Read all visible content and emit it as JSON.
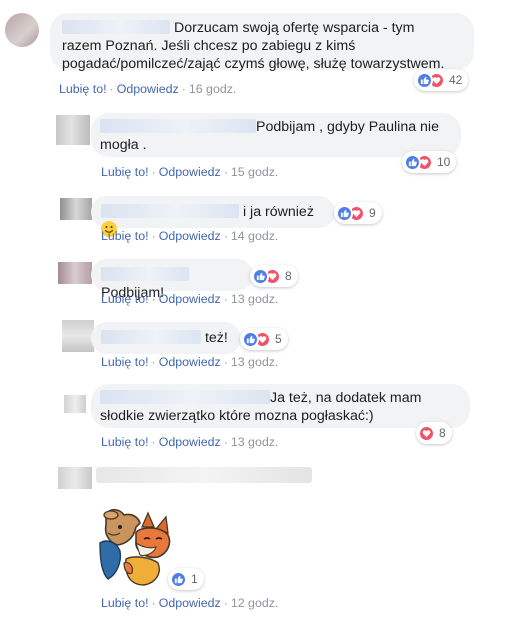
{
  "actions": {
    "like": "Lubię to!",
    "reply": "Odpowiedz",
    "separator": "·"
  },
  "colors": {
    "link": "#4267b2",
    "meta_gray": "#90949c",
    "bubble_bg": "#f2f3f5",
    "like_blue": "#4f7ee8",
    "love_red": "#f25268"
  },
  "comments": [
    {
      "text_line1": "Dorzucam swoją ofertę wsparcia - tym",
      "text_line2": "razem Poznań. Jeśli chcesz po zabiegu z kimś",
      "text_line3": "pogadać/pomilczeć/zająć czymś głowę, służę towarzystwem.",
      "reactions": [
        "like-icon",
        "love-icon"
      ],
      "count": "42",
      "time": "16 godz."
    },
    {
      "text_line1": "Podbijam , gdyby Paulina nie",
      "text_line2": "mogła .",
      "reactions": [
        "like-icon",
        "love-icon"
      ],
      "count": "10",
      "time": "15 godz."
    },
    {
      "text": "i ja również",
      "emoji": "smile-emoji",
      "reactions": [
        "like-icon",
        "love-icon"
      ],
      "count": "9",
      "time": "14 godz."
    },
    {
      "text": "Podbijam!",
      "reactions": [
        "like-icon",
        "love-icon"
      ],
      "count": "8",
      "time": "13 godz."
    },
    {
      "text": "też!",
      "reactions": [
        "like-icon",
        "love-icon"
      ],
      "count": "5",
      "time": "13 godz."
    },
    {
      "text_line1": "Ja też, na dodatek mam",
      "text_line2": "słodkie zwierzątko które mozna pogłaskać:)",
      "reactions": [
        "love-icon"
      ],
      "count": "8",
      "time": "13 godz."
    },
    {
      "sticker": "deer-and-fox-sticker",
      "reactions": [
        "like-icon"
      ],
      "count": "1",
      "time": "12 godz."
    }
  ]
}
